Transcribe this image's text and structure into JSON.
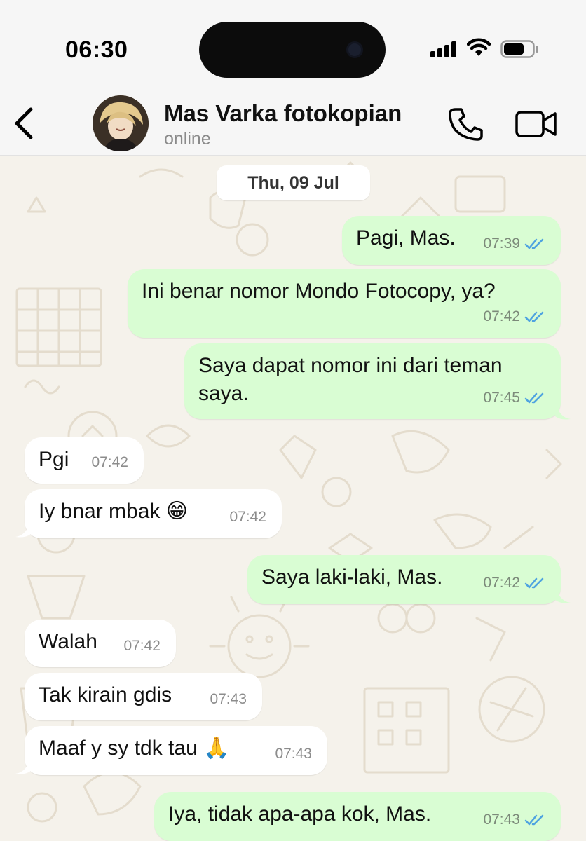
{
  "status_bar": {
    "time": "06:30"
  },
  "header": {
    "contact_name": "Mas Varka fotokopian",
    "contact_status": "online",
    "icons": [
      "chevron-left-icon",
      "phone-icon",
      "video-camera-icon"
    ]
  },
  "chat": {
    "date_chip": "Thu, 09 Jul",
    "messages": [
      {
        "direction": "out",
        "text": "Pagi, Mas.",
        "time": "07:39",
        "read": true
      },
      {
        "direction": "out",
        "text": "Ini benar nomor Mondo Fotocopy, ya?",
        "time": "07:42",
        "read": true
      },
      {
        "direction": "out",
        "text_line1": "Saya dapat nomor ini dari teman",
        "text_line2": "saya.",
        "time": "07:45",
        "read": true
      },
      {
        "direction": "in",
        "text": "Pgi",
        "time": "07:42"
      },
      {
        "direction": "in",
        "text": "Iy bnar mbak 😁",
        "time": "07:42"
      },
      {
        "direction": "out",
        "text": "Saya laki-laki, Mas.",
        "time": "07:42",
        "read": true
      },
      {
        "direction": "in",
        "text": "Walah",
        "time": "07:42"
      },
      {
        "direction": "in",
        "text": "Tak kirain gdis",
        "time": "07:43"
      },
      {
        "direction": "in",
        "text": "Maaf y sy tdk tau 🙏",
        "time": "07:43"
      },
      {
        "direction": "out",
        "text": "Iya, tidak apa-apa kok, Mas.",
        "time": "07:43",
        "read": true
      }
    ]
  },
  "colors": {
    "outgoing_bubble": "#d9fdd3",
    "incoming_bubble": "#ffffff",
    "read_ticks": "#4fa3e0",
    "wallpaper": "#f5f2eb"
  }
}
